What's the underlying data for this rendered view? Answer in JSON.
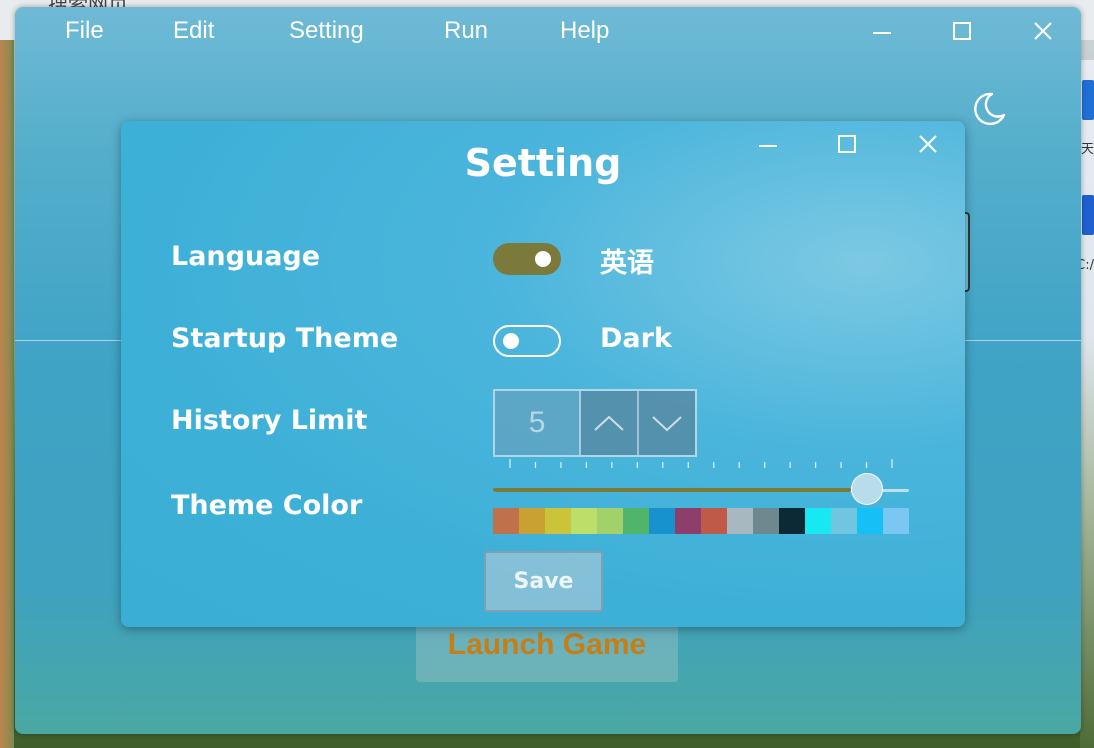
{
  "backdrop": {
    "top_text": "搜索网页",
    "side_texts": [
      "天",
      "C:/"
    ]
  },
  "menubar": {
    "items": [
      "File",
      "Edit",
      "Setting",
      "Run",
      "Help"
    ]
  },
  "window_controls": [
    "minimize-icon",
    "maximize-icon",
    "close-icon"
  ],
  "theme_toggle_icon": "moon-icon",
  "launch": {
    "label": "Launch Game"
  },
  "dialog": {
    "title": "Setting",
    "language": {
      "label": "Language",
      "value": "英语",
      "enabled": true
    },
    "startup_theme": {
      "label": "Startup Theme",
      "value": "Dark",
      "enabled": false
    },
    "history_limit": {
      "label": "History Limit",
      "value": "5"
    },
    "theme_color": {
      "label": "Theme Color",
      "slider_level": 0.9,
      "tick_count": 16,
      "fill_color": "#7b7a3a",
      "palette": [
        "#c0704a",
        "#c9a032",
        "#c9c43a",
        "#bede6a",
        "#a2d06a",
        "#4fb56a",
        "#1792cf",
        "#8e3e6a",
        "#c05a48",
        "#a8b8c0",
        "#6e8890",
        "#0c2a36",
        "#18e8f2",
        "#70c6e0",
        "#16c0f6",
        "#7ac7f2"
      ]
    },
    "save_label": "Save"
  }
}
